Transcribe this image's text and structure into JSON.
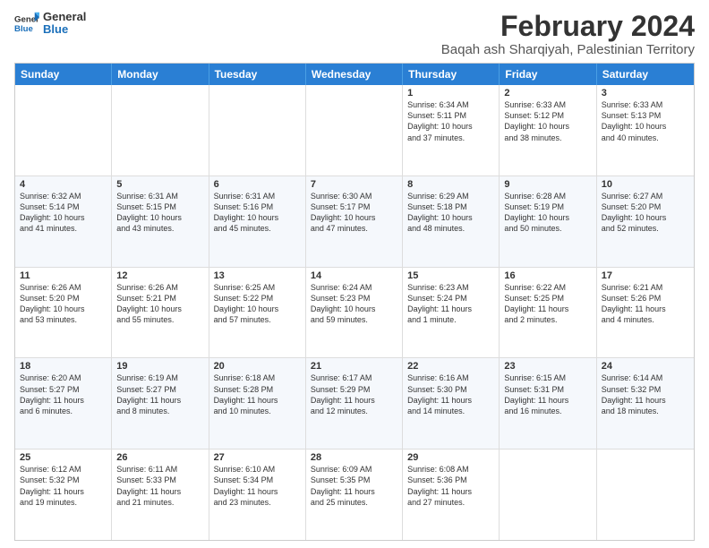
{
  "header": {
    "logo_line1": "General",
    "logo_line2": "Blue",
    "main_title": "February 2024",
    "subtitle": "Baqah ash Sharqiyah, Palestinian Territory"
  },
  "calendar": {
    "days": [
      "Sunday",
      "Monday",
      "Tuesday",
      "Wednesday",
      "Thursday",
      "Friday",
      "Saturday"
    ],
    "rows": [
      [
        {
          "num": "",
          "text": ""
        },
        {
          "num": "",
          "text": ""
        },
        {
          "num": "",
          "text": ""
        },
        {
          "num": "",
          "text": ""
        },
        {
          "num": "1",
          "text": "Sunrise: 6:34 AM\nSunset: 5:11 PM\nDaylight: 10 hours\nand 37 minutes."
        },
        {
          "num": "2",
          "text": "Sunrise: 6:33 AM\nSunset: 5:12 PM\nDaylight: 10 hours\nand 38 minutes."
        },
        {
          "num": "3",
          "text": "Sunrise: 6:33 AM\nSunset: 5:13 PM\nDaylight: 10 hours\nand 40 minutes."
        }
      ],
      [
        {
          "num": "4",
          "text": "Sunrise: 6:32 AM\nSunset: 5:14 PM\nDaylight: 10 hours\nand 41 minutes."
        },
        {
          "num": "5",
          "text": "Sunrise: 6:31 AM\nSunset: 5:15 PM\nDaylight: 10 hours\nand 43 minutes."
        },
        {
          "num": "6",
          "text": "Sunrise: 6:31 AM\nSunset: 5:16 PM\nDaylight: 10 hours\nand 45 minutes."
        },
        {
          "num": "7",
          "text": "Sunrise: 6:30 AM\nSunset: 5:17 PM\nDaylight: 10 hours\nand 47 minutes."
        },
        {
          "num": "8",
          "text": "Sunrise: 6:29 AM\nSunset: 5:18 PM\nDaylight: 10 hours\nand 48 minutes."
        },
        {
          "num": "9",
          "text": "Sunrise: 6:28 AM\nSunset: 5:19 PM\nDaylight: 10 hours\nand 50 minutes."
        },
        {
          "num": "10",
          "text": "Sunrise: 6:27 AM\nSunset: 5:20 PM\nDaylight: 10 hours\nand 52 minutes."
        }
      ],
      [
        {
          "num": "11",
          "text": "Sunrise: 6:26 AM\nSunset: 5:20 PM\nDaylight: 10 hours\nand 53 minutes."
        },
        {
          "num": "12",
          "text": "Sunrise: 6:26 AM\nSunset: 5:21 PM\nDaylight: 10 hours\nand 55 minutes."
        },
        {
          "num": "13",
          "text": "Sunrise: 6:25 AM\nSunset: 5:22 PM\nDaylight: 10 hours\nand 57 minutes."
        },
        {
          "num": "14",
          "text": "Sunrise: 6:24 AM\nSunset: 5:23 PM\nDaylight: 10 hours\nand 59 minutes."
        },
        {
          "num": "15",
          "text": "Sunrise: 6:23 AM\nSunset: 5:24 PM\nDaylight: 11 hours\nand 1 minute."
        },
        {
          "num": "16",
          "text": "Sunrise: 6:22 AM\nSunset: 5:25 PM\nDaylight: 11 hours\nand 2 minutes."
        },
        {
          "num": "17",
          "text": "Sunrise: 6:21 AM\nSunset: 5:26 PM\nDaylight: 11 hours\nand 4 minutes."
        }
      ],
      [
        {
          "num": "18",
          "text": "Sunrise: 6:20 AM\nSunset: 5:27 PM\nDaylight: 11 hours\nand 6 minutes."
        },
        {
          "num": "19",
          "text": "Sunrise: 6:19 AM\nSunset: 5:27 PM\nDaylight: 11 hours\nand 8 minutes."
        },
        {
          "num": "20",
          "text": "Sunrise: 6:18 AM\nSunset: 5:28 PM\nDaylight: 11 hours\nand 10 minutes."
        },
        {
          "num": "21",
          "text": "Sunrise: 6:17 AM\nSunset: 5:29 PM\nDaylight: 11 hours\nand 12 minutes."
        },
        {
          "num": "22",
          "text": "Sunrise: 6:16 AM\nSunset: 5:30 PM\nDaylight: 11 hours\nand 14 minutes."
        },
        {
          "num": "23",
          "text": "Sunrise: 6:15 AM\nSunset: 5:31 PM\nDaylight: 11 hours\nand 16 minutes."
        },
        {
          "num": "24",
          "text": "Sunrise: 6:14 AM\nSunset: 5:32 PM\nDaylight: 11 hours\nand 18 minutes."
        }
      ],
      [
        {
          "num": "25",
          "text": "Sunrise: 6:12 AM\nSunset: 5:32 PM\nDaylight: 11 hours\nand 19 minutes."
        },
        {
          "num": "26",
          "text": "Sunrise: 6:11 AM\nSunset: 5:33 PM\nDaylight: 11 hours\nand 21 minutes."
        },
        {
          "num": "27",
          "text": "Sunrise: 6:10 AM\nSunset: 5:34 PM\nDaylight: 11 hours\nand 23 minutes."
        },
        {
          "num": "28",
          "text": "Sunrise: 6:09 AM\nSunset: 5:35 PM\nDaylight: 11 hours\nand 25 minutes."
        },
        {
          "num": "29",
          "text": "Sunrise: 6:08 AM\nSunset: 5:36 PM\nDaylight: 11 hours\nand 27 minutes."
        },
        {
          "num": "",
          "text": ""
        },
        {
          "num": "",
          "text": ""
        }
      ]
    ]
  }
}
